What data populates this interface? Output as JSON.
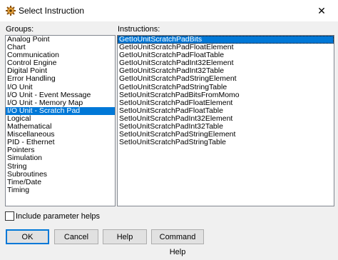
{
  "window": {
    "title": "Select Instruction",
    "close_glyph": "✕"
  },
  "groups": {
    "label": "Groups:",
    "items": [
      "Analog Point",
      "Chart",
      "Communication",
      "Control Engine",
      "Digital Point",
      "Error Handling",
      "I/O Unit",
      "I/O Unit - Event Message",
      "I/O Unit - Memory Map",
      "I/O Unit - Scratch Pad",
      "Logical",
      "Mathematical",
      "Miscellaneous",
      "PID - Ethernet",
      "Pointers",
      "Simulation",
      "String",
      "Subroutines",
      "Time/Date",
      "Timing"
    ],
    "selected_index": 9
  },
  "instructions": {
    "label": "Instructions:",
    "items": [
      "GetIoUnitScratchPadBits",
      "GetIoUnitScratchPadFloatElement",
      "GetIoUnitScratchPadFloatTable",
      "GetIoUnitScratchPadInt32Element",
      "GetIoUnitScratchPadInt32Table",
      "GetIoUnitScratchPadStringElement",
      "GetIoUnitScratchPadStringTable",
      "SetIoUnitScratchPadBitsFromMomo",
      "SetIoUnitScratchPadFloatElement",
      "SetIoUnitScratchPadFloatTable",
      "SetIoUnitScratchPadInt32Element",
      "SetIoUnitScratchPadInt32Table",
      "SetIoUnitScratchPadStringElement",
      "SetIoUnitScratchPadStringTable"
    ],
    "selected_index": 0
  },
  "options": {
    "include_parameter_helps": "Include parameter helps",
    "include_parameter_helps_checked": false
  },
  "buttons": {
    "ok": "OK",
    "cancel": "Cancel",
    "help": "Help",
    "command_help": "Command Help"
  },
  "colors": {
    "selection": "#0078d7"
  }
}
